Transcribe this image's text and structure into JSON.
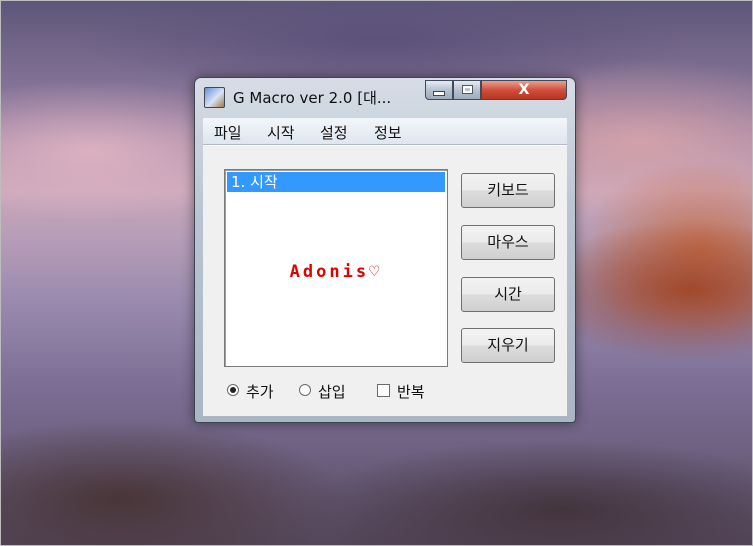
{
  "window": {
    "title": "G Macro  ver 2.0  [대...",
    "close_glyph": "X"
  },
  "menu": [
    "파일",
    "시작",
    "설정",
    "정보"
  ],
  "list": {
    "items": [
      "1.  시작"
    ],
    "watermark": "Adonis♡"
  },
  "buttons": {
    "keyboard": "키보드",
    "mouse": "마우스",
    "time": "시간",
    "erase": "지우기"
  },
  "options": {
    "add": "추가",
    "insert": "삽입",
    "repeat": "반복",
    "selected": "add"
  },
  "colors": {
    "selection": "#3399ff",
    "watermark": "#e00000",
    "close_button": "#c8452f"
  }
}
